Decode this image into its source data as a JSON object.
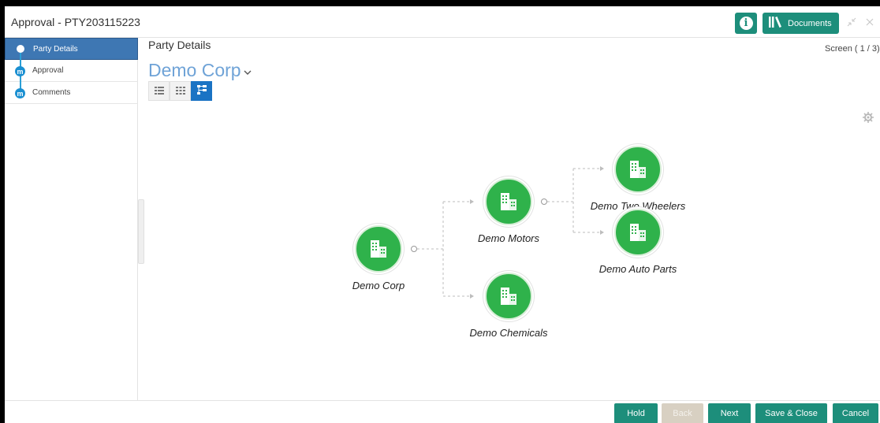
{
  "window": {
    "title": "Approval - PTY203115223",
    "documents_label": "Documents"
  },
  "sidebar": {
    "items": [
      {
        "label": "Party Details",
        "active": true
      },
      {
        "label": "Approval",
        "active": false
      },
      {
        "label": "Comments",
        "active": false
      }
    ]
  },
  "main": {
    "title": "Party Details",
    "screen_indicator": "Screen ( 1 / 3)",
    "entity_title": "Demo Corp"
  },
  "tree": {
    "root": "Demo Corp",
    "level1": [
      "Demo Motors",
      "Demo Chemicals"
    ],
    "level2": [
      "Demo Two Wheelers",
      "Demo Auto Parts"
    ]
  },
  "footer": {
    "hold": "Hold",
    "back": "Back",
    "next": "Next",
    "save_close": "Save & Close",
    "cancel": "Cancel"
  },
  "colors": {
    "accent": "#1d8e7b",
    "node_green": "#2fb24b",
    "active_nav": "#3e77b3",
    "entity_title": "#6fa3d7"
  }
}
